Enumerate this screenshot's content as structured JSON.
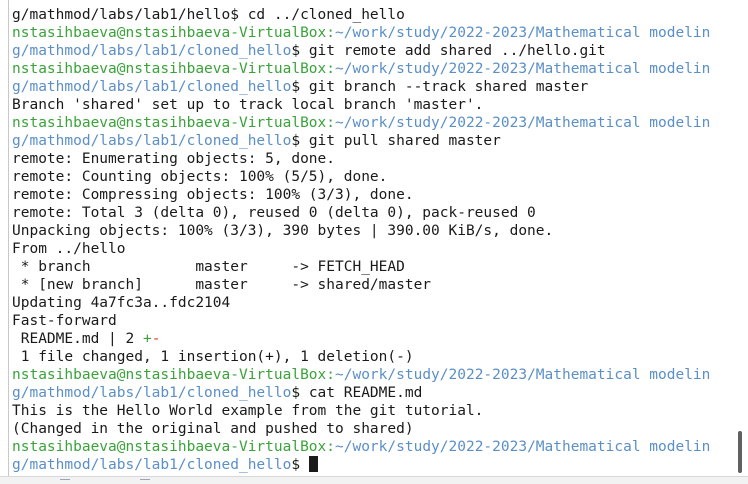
{
  "terminal": {
    "lines": [
      {
        "segments": [
          {
            "text": "g/mathmod/labs/lab1/hello$ cd ../cloned_hello",
            "style": "plain"
          }
        ]
      },
      {
        "segments": [
          {
            "text": "nstasihbaeva@nstasihbaeva-VirtualBox:",
            "style": "user"
          },
          {
            "text": "~/work/study/2022-2023/Mathematical modelin",
            "style": "path"
          }
        ]
      },
      {
        "segments": [
          {
            "text": "g/mathmod/labs/lab1/cloned_hello",
            "style": "path"
          },
          {
            "text": "$ git remote add shared ../hello.git",
            "style": "plain"
          }
        ]
      },
      {
        "segments": [
          {
            "text": "nstasihbaeva@nstasihbaeva-VirtualBox:",
            "style": "user"
          },
          {
            "text": "~/work/study/2022-2023/Mathematical modelin",
            "style": "path"
          }
        ]
      },
      {
        "segments": [
          {
            "text": "g/mathmod/labs/lab1/cloned_hello",
            "style": "path"
          },
          {
            "text": "$ git branch --track shared master",
            "style": "plain"
          }
        ]
      },
      {
        "segments": [
          {
            "text": "Branch 'shared' set up to track local branch 'master'.",
            "style": "plain"
          }
        ]
      },
      {
        "segments": [
          {
            "text": "nstasihbaeva@nstasihbaeva-VirtualBox:",
            "style": "user"
          },
          {
            "text": "~/work/study/2022-2023/Mathematical modelin",
            "style": "path"
          }
        ]
      },
      {
        "segments": [
          {
            "text": "g/mathmod/labs/lab1/cloned_hello",
            "style": "path"
          },
          {
            "text": "$ git pull shared master",
            "style": "plain"
          }
        ]
      },
      {
        "segments": [
          {
            "text": "remote: Enumerating objects: 5, done.",
            "style": "plain"
          }
        ]
      },
      {
        "segments": [
          {
            "text": "remote: Counting objects: 100% (5/5), done.",
            "style": "plain"
          }
        ]
      },
      {
        "segments": [
          {
            "text": "remote: Compressing objects: 100% (3/3), done.",
            "style": "plain"
          }
        ]
      },
      {
        "segments": [
          {
            "text": "remote: Total 3 (delta 0), reused 0 (delta 0), pack-reused 0",
            "style": "plain"
          }
        ]
      },
      {
        "segments": [
          {
            "text": "Unpacking objects: 100% (3/3), 390 bytes | 390.00 KiB/s, done.",
            "style": "plain"
          }
        ]
      },
      {
        "segments": [
          {
            "text": "From ../hello",
            "style": "plain"
          }
        ]
      },
      {
        "segments": [
          {
            "text": " * branch            master     -> FETCH_HEAD",
            "style": "plain"
          }
        ]
      },
      {
        "segments": [
          {
            "text": " * [new branch]      master     -> shared/master",
            "style": "plain"
          }
        ]
      },
      {
        "segments": [
          {
            "text": "Updating 4a7fc3a..fdc2104",
            "style": "plain"
          }
        ]
      },
      {
        "segments": [
          {
            "text": "Fast-forward",
            "style": "plain"
          }
        ]
      },
      {
        "segments": [
          {
            "text": " README.md | 2 ",
            "style": "plain"
          },
          {
            "text": "+",
            "style": "plus"
          },
          {
            "text": "-",
            "style": "minus"
          }
        ]
      },
      {
        "segments": [
          {
            "text": " 1 file changed, 1 insertion(+), 1 deletion(-)",
            "style": "plain"
          }
        ]
      },
      {
        "segments": [
          {
            "text": "nstasihbaeva@nstasihbaeva-VirtualBox:",
            "style": "user"
          },
          {
            "text": "~/work/study/2022-2023/Mathematical modelin",
            "style": "path"
          }
        ]
      },
      {
        "segments": [
          {
            "text": "g/mathmod/labs/lab1/cloned_hello",
            "style": "path"
          },
          {
            "text": "$ cat README.md",
            "style": "plain"
          }
        ]
      },
      {
        "segments": [
          {
            "text": "This is the Hello World example from the git tutorial.",
            "style": "plain"
          }
        ]
      },
      {
        "segments": [
          {
            "text": "(Changed in the original and pushed to shared)",
            "style": "plain"
          }
        ]
      },
      {
        "segments": [
          {
            "text": "nstasihbaeva@nstasihbaeva-VirtualBox:",
            "style": "user"
          },
          {
            "text": "~/work/study/2022-2023/Mathematical modelin",
            "style": "path"
          }
        ]
      },
      {
        "segments": [
          {
            "text": "g/mathmod/labs/lab1/cloned_hello",
            "style": "path"
          },
          {
            "text": "$ ",
            "style": "plain"
          }
        ],
        "cursor": true
      }
    ]
  },
  "colors": {
    "background": "#ffffff",
    "user_host": "#3aa33a",
    "path": "#5b8fc7",
    "text": "#1a1a1a",
    "diff_plus": "#3aa33a",
    "diff_minus": "#d83a3a"
  }
}
